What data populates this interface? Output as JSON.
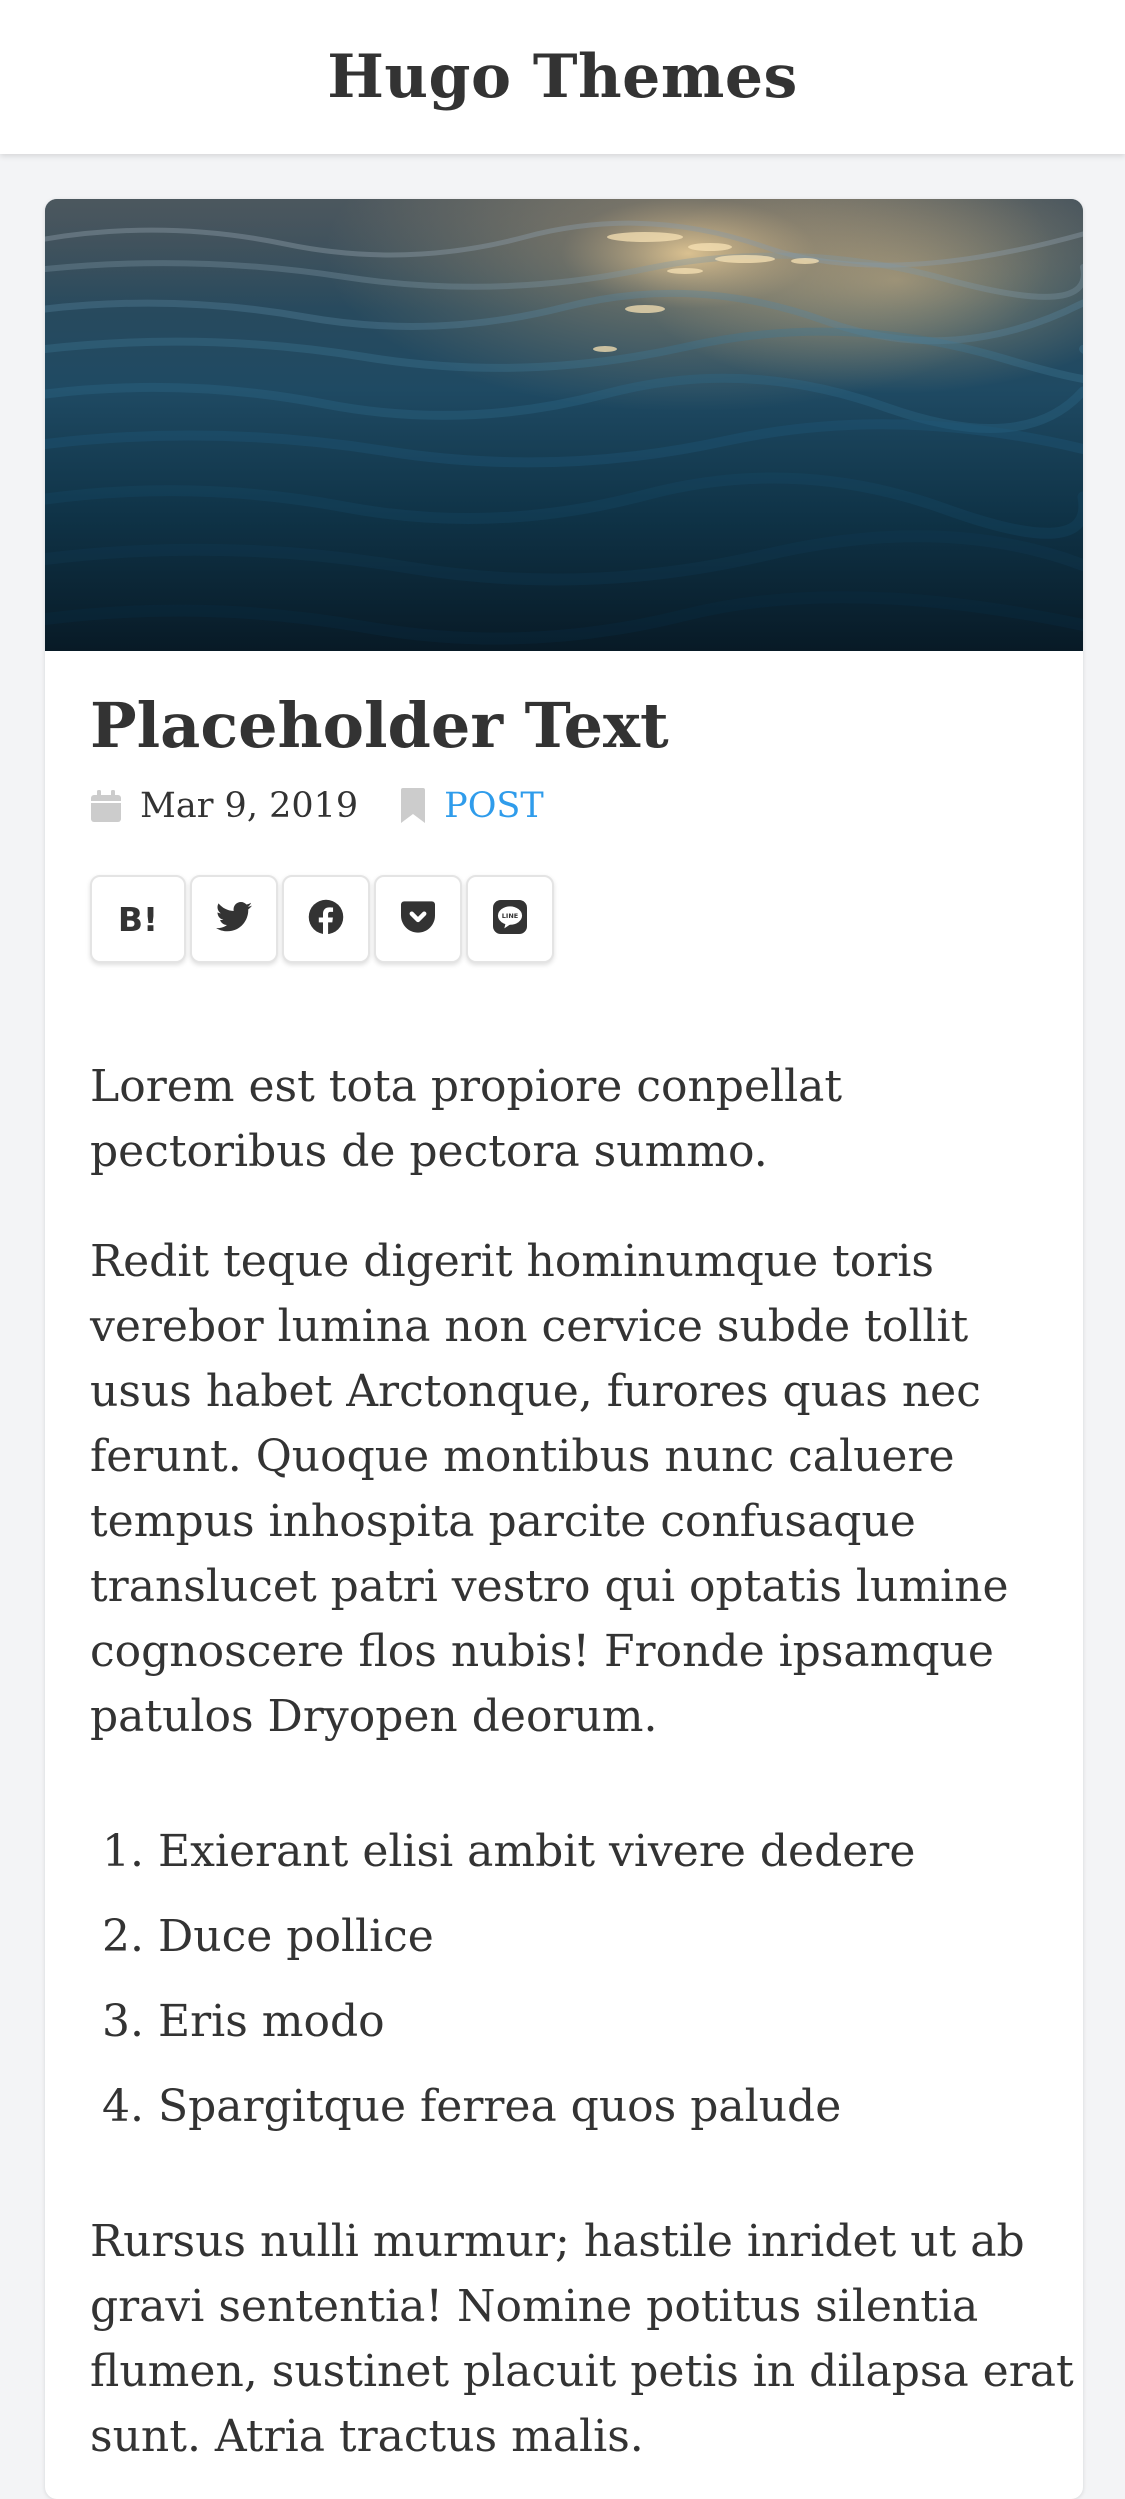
{
  "header": {
    "site_title": "Hugo Themes"
  },
  "post": {
    "hero_image": "ocean-waves-photo",
    "title": "Placeholder Text",
    "date": "Mar 9, 2019",
    "category": "POST"
  },
  "share_buttons": [
    {
      "label": "B!",
      "icon": "hatena-bookmark-icon"
    },
    {
      "label": "",
      "icon": "twitter-icon"
    },
    {
      "label": "",
      "icon": "facebook-icon"
    },
    {
      "label": "",
      "icon": "pocket-icon"
    },
    {
      "label": "",
      "icon": "line-icon"
    }
  ],
  "content": {
    "paragraphs": [
      "Lorem est tota propiore conpellat pectoribus de pectora summo.",
      "Redit teque digerit hominumque toris verebor lumina non cervice subde tollit usus habet Arctonque, furores quas nec ferunt. Quoque montibus nunc caluere tempus inhospita parcite confusaque translucet patri vestro qui optatis lumine cognoscere flos nubis! Fronde ipsamque patulos Dryopen deorum.",
      "Rursus nulli murmur; hastile inridet ut ab gravi sententia! Nomine potitus silentia flumen, sustinet placuit petis in dilapsa erat sunt. Atria tractus malis."
    ],
    "list_items": [
      "Exierant elisi ambit vivere dedere",
      "Duce pollice",
      "Eris modo",
      "Spargitque ferrea quos palude"
    ]
  },
  "colors": {
    "accent": "#2f9ceb",
    "text": "#333333",
    "background": "#f3f4f6"
  }
}
